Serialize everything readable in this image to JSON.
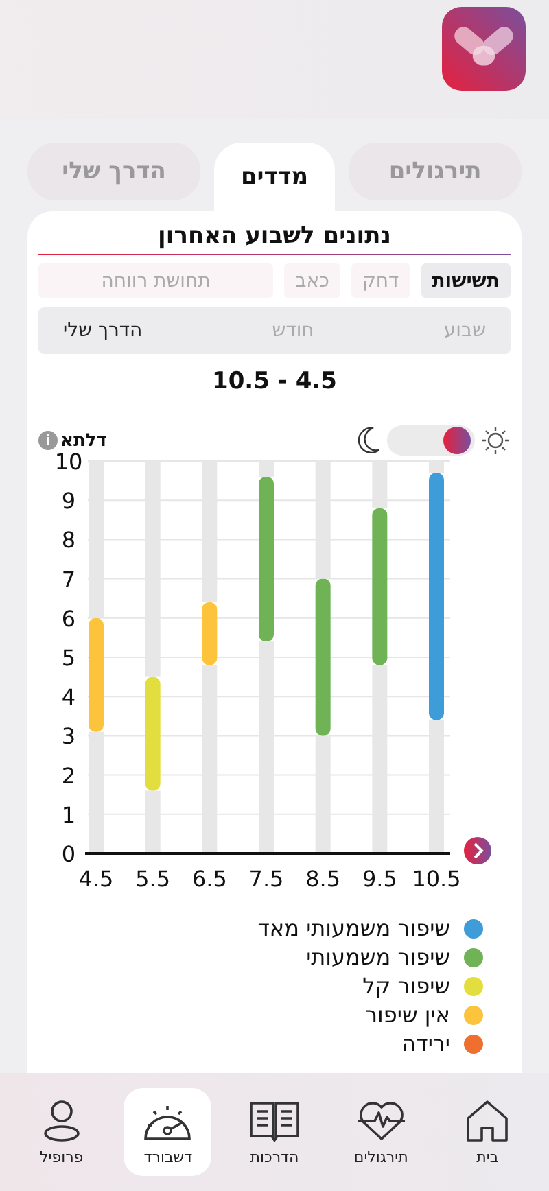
{
  "tabs": [
    {
      "label": "תירגולים",
      "selected": false
    },
    {
      "label": "מדדים",
      "selected": true
    },
    {
      "label": "הדרך שלי",
      "selected": false
    }
  ],
  "card_title": "נתונים לשבוע האחרון",
  "filters": [
    {
      "label": "תשישות",
      "selected": true
    },
    {
      "label": "דחק",
      "selected": false
    },
    {
      "label": "כאב",
      "selected": false
    },
    {
      "label": "תחושת רווחה",
      "selected": false
    }
  ],
  "periods": [
    {
      "label": "שבוע",
      "selected": false
    },
    {
      "label": "חודש",
      "selected": false
    },
    {
      "label": "הדרך שלי",
      "selected": true
    }
  ],
  "range_label": "10.5 - 4.5",
  "delta_label": "דלתא",
  "info_icon": "i",
  "theme_toggle": {
    "on": true
  },
  "chart_data": {
    "type": "bar",
    "stacked": true,
    "grid": true,
    "categories": [
      "4.5",
      "5.5",
      "6.5",
      "7.5",
      "8.5",
      "9.5",
      "10.5"
    ],
    "ylim": [
      0,
      10
    ],
    "yticks": [
      0,
      1,
      2,
      3,
      4,
      5,
      6,
      7,
      8,
      9,
      10
    ],
    "series": [
      {
        "color": "#e7e7e7",
        "values": [
          3.1,
          1.6,
          4.8,
          5.4,
          3.0,
          4.8,
          3.4
        ]
      },
      {
        "name": "שיפור משמעותי מאד",
        "color": "#3e9cd8",
        "values": [
          null,
          null,
          null,
          null,
          null,
          null,
          6.3
        ]
      },
      {
        "name": "שיפור משמעותי",
        "color": "#70b256",
        "values": [
          null,
          null,
          null,
          4.2,
          4.0,
          4.0,
          null
        ]
      },
      {
        "name": "שיפור קל",
        "color": "#e3de3f",
        "values": [
          null,
          2.9,
          null,
          null,
          null,
          null,
          null
        ]
      },
      {
        "name": "אין שיפור",
        "color": "#fbc43c",
        "values": [
          2.9,
          null,
          1.6,
          null,
          null,
          null,
          null
        ]
      },
      {
        "name": "ירידה",
        "color": "#ef6f2e",
        "values": [
          null,
          null,
          null,
          null,
          null,
          null,
          null
        ]
      },
      {
        "color": "#e7e7e7",
        "values": [
          4.0,
          5.5,
          3.6,
          0.4,
          3.0,
          1.2,
          0.3
        ]
      }
    ]
  },
  "nav": [
    {
      "label": "בית",
      "kind": "home",
      "selected": false
    },
    {
      "label": "תירגולים",
      "kind": "heart",
      "selected": false
    },
    {
      "label": "הדרכות",
      "kind": "book",
      "selected": false
    },
    {
      "label": "דשבורד",
      "kind": "gauge",
      "selected": true
    },
    {
      "label": "פרופיל",
      "kind": "person",
      "selected": false
    }
  ]
}
